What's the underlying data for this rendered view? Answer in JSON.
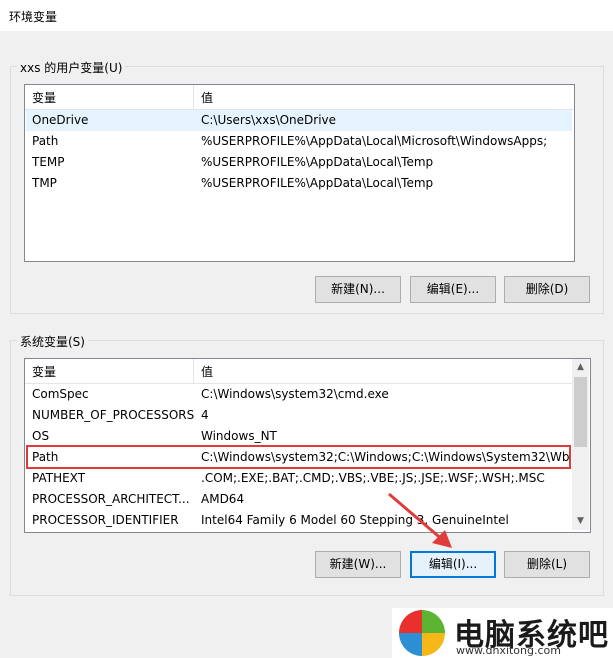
{
  "window": {
    "title": "环境变量"
  },
  "user_vars": {
    "group_label": "xxs 的用户变量(U)",
    "columns": [
      "变量",
      "值"
    ],
    "rows": [
      {
        "name": "OneDrive",
        "value": "C:\\Users\\xxs\\OneDrive",
        "selected": true
      },
      {
        "name": "Path",
        "value": "%USERPROFILE%\\AppData\\Local\\Microsoft\\WindowsApps;"
      },
      {
        "name": "TEMP",
        "value": "%USERPROFILE%\\AppData\\Local\\Temp"
      },
      {
        "name": "TMP",
        "value": "%USERPROFILE%\\AppData\\Local\\Temp"
      }
    ],
    "buttons": {
      "new": "新建(N)...",
      "edit": "编辑(E)...",
      "delete": "删除(D)"
    }
  },
  "system_vars": {
    "group_label": "系统变量(S)",
    "columns": [
      "变量",
      "值"
    ],
    "rows": [
      {
        "name": "ComSpec",
        "value": "C:\\Windows\\system32\\cmd.exe"
      },
      {
        "name": "NUMBER_OF_PROCESSORS",
        "value": "4"
      },
      {
        "name": "OS",
        "value": "Windows_NT"
      },
      {
        "name": "Path",
        "value": "C:\\Windows\\system32;C:\\Windows;C:\\Windows\\System32\\Wb...",
        "highlighted": true
      },
      {
        "name": "PATHEXT",
        "value": ".COM;.EXE;.BAT;.CMD;.VBS;.VBE;.JS;.JSE;.WSF;.WSH;.MSC"
      },
      {
        "name": "PROCESSOR_ARCHITECT...",
        "value": "AMD64"
      },
      {
        "name": "PROCESSOR_IDENTIFIER",
        "value": "Intel64 Family 6 Model 60 Stepping 3, GenuineIntel"
      }
    ],
    "buttons": {
      "new": "新建(W)...",
      "edit": "编辑(I)...",
      "delete": "删除(L)"
    }
  },
  "watermark": {
    "brand": "电脑系统吧",
    "url": "www.dnxitong.com"
  },
  "colors": {
    "highlight": "#e03c3c",
    "focus": "#0078d7",
    "selected_row": "#e5f3ff"
  }
}
